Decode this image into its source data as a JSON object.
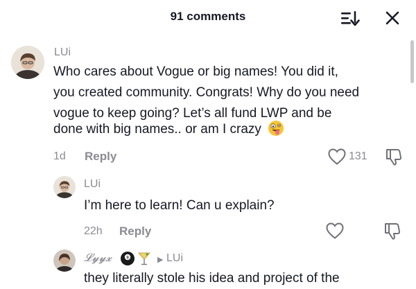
{
  "header": {
    "title": "91 comments",
    "sort_icon": "sort-list-icon",
    "close_icon": "close-icon"
  },
  "comments": [
    {
      "username": "LUi",
      "text_lines": [
        "Who cares about Vogue or big names! You did it,",
        "you created community. Congrats! Why do you need",
        "vogue to keep going? Let’s all fund LWP and be",
        "done with big names.. or am I crazy"
      ],
      "emoji": "zany-face-emoji",
      "time": "1d",
      "reply_label": "Reply",
      "like_count": "131"
    },
    {
      "username": "LUi",
      "text": "I’m here to learn! Can u explain?",
      "time": "22h",
      "reply_label": "Reply"
    },
    {
      "username": "𝓛𝔂𝔂𝔁",
      "reply_to": "LUi",
      "text": "they literally stole his idea and project of the"
    }
  ],
  "colors": {
    "text": "#161823",
    "muted": "#8a8b91",
    "background": "#ffffff"
  }
}
